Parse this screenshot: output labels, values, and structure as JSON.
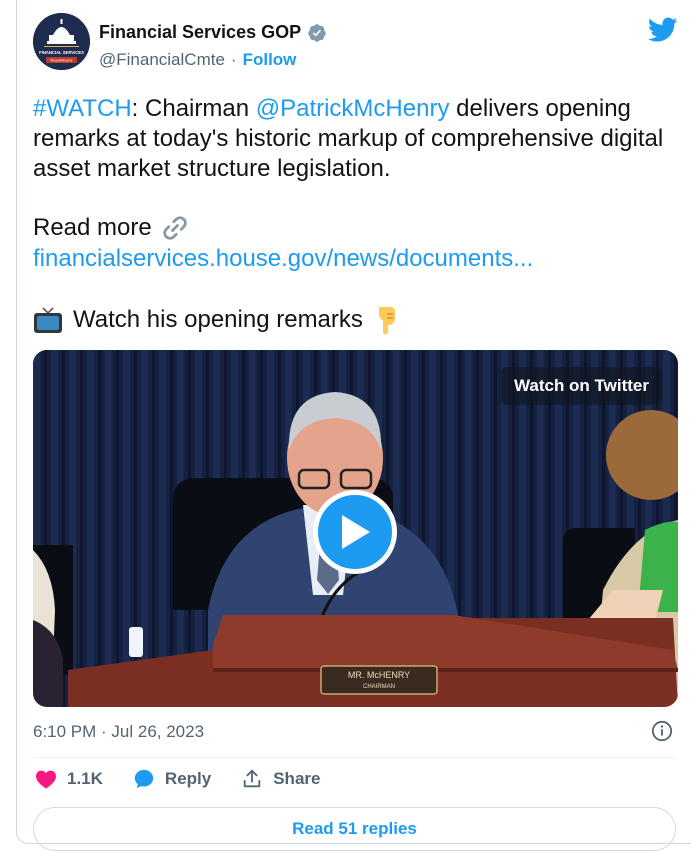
{
  "account": {
    "display_name": "Financial Services GOP",
    "handle": "@FinancialCmte",
    "separator": "·",
    "follow_label": "Follow",
    "avatar_line1": "FINANCIAL SERVICES",
    "avatar_line2": "Republicans"
  },
  "tweet": {
    "hashtag": "#WATCH",
    "text_part1": ": Chairman ",
    "mention": "@PatrickMcHenry",
    "text_part2": " delivers opening remarks at today's historic markup of comprehensive digital asset market structure legislation.",
    "read_more": "Read more",
    "url": "financialservices.house.gov/news/documents...",
    "watch_line": "Watch his opening remarks"
  },
  "video": {
    "watch_on_twitter": "Watch on Twitter",
    "nameplate_line1": "MR. McHENRY",
    "nameplate_line2": "CHAIRMAN"
  },
  "timestamp": "6:10 PM · Jul 26, 2023",
  "actions": {
    "like_count": "1.1K",
    "reply_label": "Reply",
    "share_label": "Share"
  },
  "read_replies_label": "Read 51 replies",
  "colors": {
    "accent": "#1d9bf0",
    "like": "#f91880",
    "muted": "#536471"
  },
  "icons": [
    "verified-badge-icon",
    "twitter-bird-icon",
    "link-icon",
    "tv-icon",
    "pointing-down-icon",
    "play-icon",
    "info-icon",
    "heart-icon",
    "reply-bubble-icon",
    "share-icon"
  ]
}
